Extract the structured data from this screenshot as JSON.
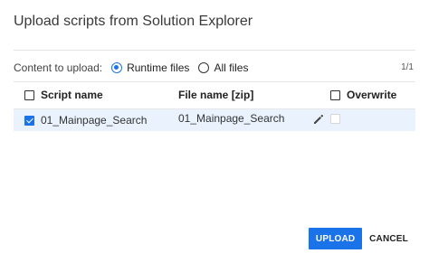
{
  "dialog": {
    "title": "Upload scripts from Solution Explorer"
  },
  "options": {
    "label": "Content to upload:",
    "radios": [
      {
        "label": "Runtime files",
        "checked": true
      },
      {
        "label": "All files",
        "checked": false
      }
    ],
    "page_count": "1/1"
  },
  "table": {
    "columns": {
      "script_name": "Script name",
      "file_name": "File name [zip]",
      "overwrite": "Overwrite"
    },
    "rows": [
      {
        "checked": true,
        "script_name": "01_Mainpage_Search",
        "file_name": "01_Mainpage_Search",
        "overwrite": false
      }
    ]
  },
  "buttons": {
    "upload": "UPLOAD",
    "cancel": "CANCEL"
  },
  "colors": {
    "accent": "#1a73e8",
    "row_highlight": "#eaf3fd"
  },
  "icons": {
    "edit": "pencil-icon"
  }
}
